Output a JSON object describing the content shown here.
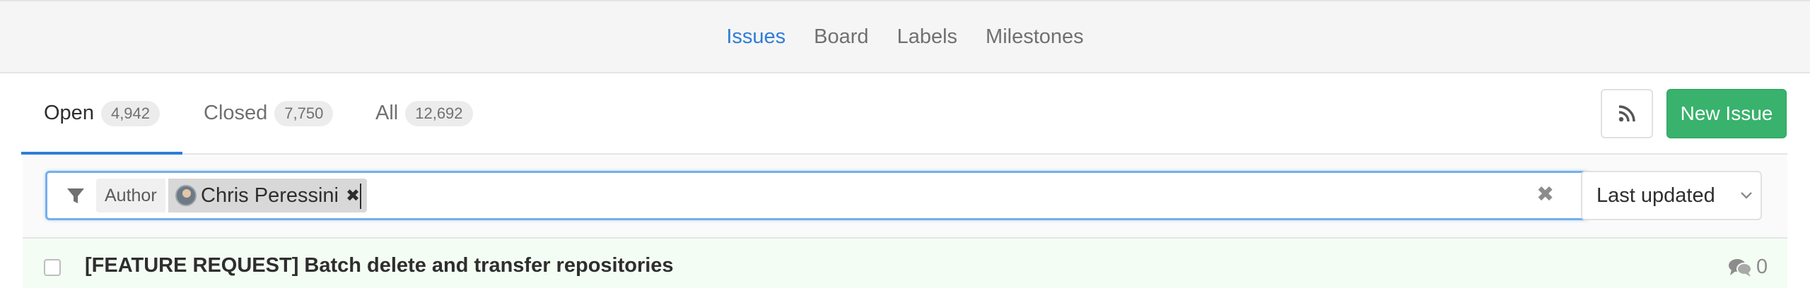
{
  "subnav": {
    "items": [
      {
        "label": "Issues",
        "active": true
      },
      {
        "label": "Board",
        "active": false
      },
      {
        "label": "Labels",
        "active": false
      },
      {
        "label": "Milestones",
        "active": false
      }
    ]
  },
  "tabs": [
    {
      "label": "Open",
      "count": "4,942",
      "active": true
    },
    {
      "label": "Closed",
      "count": "7,750",
      "active": false
    },
    {
      "label": "All",
      "count": "12,692",
      "active": false
    }
  ],
  "actions": {
    "rss_icon": "rss-icon",
    "new_issue_label": "New Issue"
  },
  "filter": {
    "token_name": "Author",
    "token_value": "Chris Peressini",
    "remove_glyph": "✖",
    "clear_glyph": "✖"
  },
  "sort": {
    "selected": "Last updated"
  },
  "issues": [
    {
      "title": "[FEATURE REQUEST] Batch delete and transfer repositories",
      "comments": "0"
    }
  ],
  "colors": {
    "accent": "#2e7ed6",
    "new_issue_bg": "#38b26c",
    "issue_row_bg": "#f4fdf3"
  }
}
